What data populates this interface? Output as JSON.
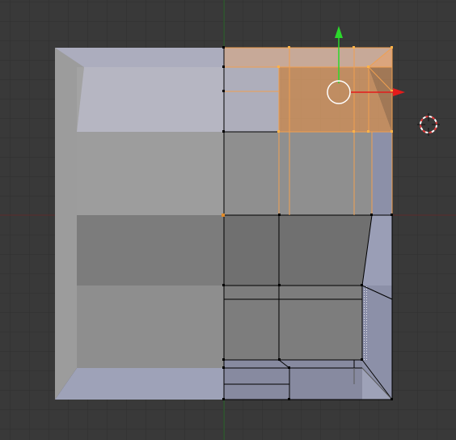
{
  "viewport": {
    "view": "front-orthographic",
    "mode": "edit-mode",
    "background_color": "#393939",
    "grid_color": "#303030",
    "x_axis_color": "#5a2c2c",
    "z_axis_color": "#2c6a2c"
  },
  "mesh": {
    "object": "cube",
    "face_color": "#9a9a9a",
    "selection_color": "#f0a050",
    "selected_vertex_color": "#ffb347",
    "wire_color": "#000000"
  },
  "manipulator": {
    "type": "translate",
    "x_arrow_color": "#e41b1b",
    "z_arrow_color": "#2bd82b",
    "center_ring_color": "#ffffff"
  },
  "cursor_3d": {
    "icon": "3d-cursor-icon",
    "ring_colors": [
      "#e33b3b",
      "#ffffff"
    ]
  }
}
